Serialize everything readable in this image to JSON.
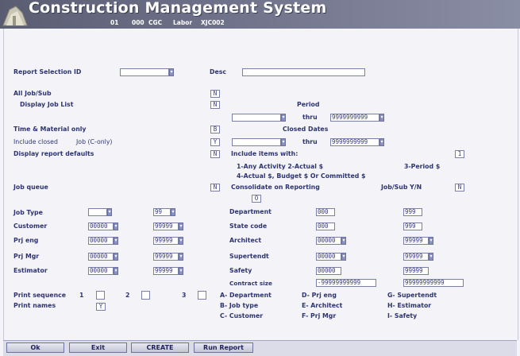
{
  "app": {
    "title": "Construction Management System",
    "sub": [
      "01",
      "000",
      "CGC",
      "Labor",
      "XJC002"
    ]
  },
  "form": {
    "report_selection_label": "Report Selection ID",
    "report_selection_value": "",
    "desc_label": "Desc",
    "desc_value": "",
    "all_job_sub_label": "All   Job/Sub",
    "all_job_sub_value": "N",
    "display_job_list_label": "Display   Job List",
    "display_job_list_value": "N",
    "period_label": "Period",
    "period_from": "",
    "period_thru_label": "thru",
    "period_thru": "9999999999",
    "tm_only_label": "Time & Material only",
    "tm_only_value": "B",
    "closed_dates_label": "Closed Dates",
    "include_closed_label": "Include closed",
    "job_c_only_label": "Job (C-only)",
    "include_closed_value": "Y",
    "closed_from": "",
    "closed_thru_label": "thru",
    "closed_thru": "9999999999",
    "display_defaults_label": "Display report defaults",
    "display_defaults_value": "N",
    "include_items_label": "Include items with:",
    "include_items_value": "1",
    "items_opt1": "1-Any Activity  2-Actual $",
    "items_opt3": "3-Period $",
    "items_opt4": "4-Actual $, Budget $ Or Committed $",
    "job_queue_label": "Job queue",
    "job_queue_value": "N",
    "consolidate_label": "Consolidate on Reporting",
    "consolidate_value": "O",
    "job_sub_yn_label": "Job/Sub Y/N",
    "job_sub_yn_value": "N"
  },
  "ranges": {
    "job_type": {
      "label": "Job Type",
      "from": "",
      "to": "99"
    },
    "customer": {
      "label": "Customer",
      "from": "00000",
      "to": "99999"
    },
    "prj_eng": {
      "label": "Prj eng",
      "from": "00000",
      "to": "99999"
    },
    "prj_mgr": {
      "label": "Prj Mgr",
      "from": "00000",
      "to": "99999"
    },
    "estimator": {
      "label": "Estimator",
      "from": "00000",
      "to": "99999"
    },
    "department": {
      "label": "Department",
      "from": "000",
      "to": "999"
    },
    "state_code": {
      "label": "State code",
      "from": "000",
      "to": "999"
    },
    "architect": {
      "label": "Architect",
      "from": "00000",
      "to": "99999"
    },
    "supertendt": {
      "label": "Supertendt",
      "from": "00000",
      "to": "99999"
    },
    "safety": {
      "label": "Safety",
      "from": "00000",
      "to": "99999"
    },
    "contract_size": {
      "label": "Contract size",
      "from": "-99999999999",
      "to": "99999999999"
    }
  },
  "print": {
    "sequence_label": "Print sequence",
    "seq1": "1",
    "seq2": "2",
    "seq3": "3",
    "names_label": "Print names",
    "names_value": "Y",
    "legend": {
      "a": "A- Department",
      "b": "B-  Job type",
      "c": "C- Customer",
      "d": "D- Prj eng",
      "e": "E- Architect",
      "f": "F- Prj Mgr",
      "g": "G- Supertendt",
      "h": "H- Estimator",
      "i": "I- Safety"
    }
  },
  "buttons": {
    "ok": "Ok",
    "exit": "Exit",
    "create": "CREATE",
    "run": "Run Report"
  },
  "colors": {
    "banner": "#6d7088",
    "label": "#2e3470",
    "field_border": "#7a7fa8"
  }
}
